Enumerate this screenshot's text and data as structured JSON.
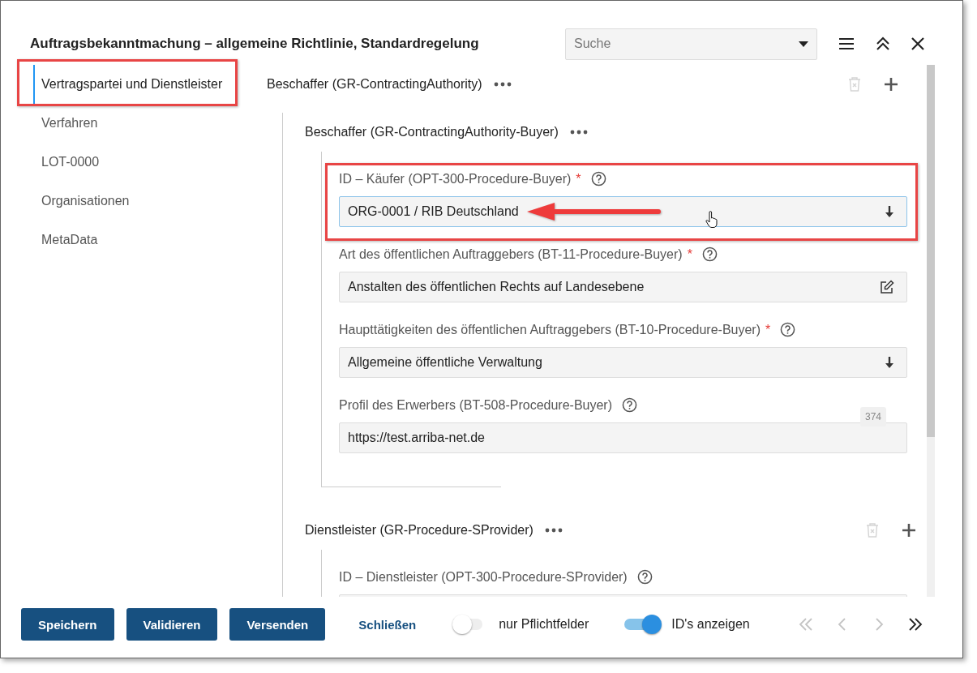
{
  "window": {
    "title": "Auftragsbekanntmachung – allgemeine Richtlinie, Standardregelung"
  },
  "search": {
    "placeholder": "Suche"
  },
  "sidebar": {
    "items": [
      {
        "label": "Vertragspartei und Dienstleister",
        "selected": true,
        "highlighted": true
      },
      {
        "label": "Verfahren",
        "selected": false
      },
      {
        "label": "LOT-0000",
        "selected": false
      },
      {
        "label": "Organisationen",
        "selected": false
      },
      {
        "label": "MetaData",
        "selected": false
      }
    ]
  },
  "group": {
    "title": "Beschaffer (GR-ContractingAuthority)",
    "delete_disabled": true,
    "subgroups": [
      {
        "title": "Beschaffer (GR-ContractingAuthority-Buyer)",
        "fields": [
          {
            "kind": "dropdown",
            "label": "ID – Käufer (OPT-300-Procedure-Buyer)",
            "required_mark": "*",
            "value": "ORG-0001 / RIB Deutschland",
            "focused": true,
            "highlighted": true,
            "pointer_arrow": true,
            "hover_cursor": true
          },
          {
            "kind": "edit",
            "label": "Art des öffentlichen Auftraggebers (BT-11-Procedure-Buyer)",
            "required_mark": "*",
            "value": "Anstalten des öffentlichen Rechts auf Landesebene",
            "focused": false
          },
          {
            "kind": "dropdown",
            "label": "Haupttätigkeiten des öffentlichen Auftraggebers (BT-10-Procedure-Buyer)",
            "required_mark": "*",
            "value": "Allgemeine öffentliche Verwaltung",
            "focused": false
          },
          {
            "kind": "text",
            "label": "Profil des Erwerbers (BT-508-Procedure-Buyer)",
            "value": "https://test.arriba-net.de",
            "counter": "374",
            "focused": false
          }
        ]
      },
      {
        "title": "Dienstleister (GR-Procedure-SProvider)",
        "delete_disabled": true,
        "fields": [
          {
            "kind": "dropdown",
            "label": "ID – Dienstleister (OPT-300-Procedure-SProvider)",
            "focused": false
          }
        ]
      }
    ]
  },
  "footer": {
    "buttons": [
      "Speichern",
      "Validieren",
      "Versenden"
    ],
    "link": "Schließen",
    "toggles": [
      {
        "label": "nur Pflichtfelder",
        "on": false
      },
      {
        "label": "ID's anzeigen",
        "on": true
      }
    ],
    "nav": [
      {
        "kind": "first",
        "disabled": true
      },
      {
        "kind": "prev",
        "disabled": true
      },
      {
        "kind": "next",
        "disabled": true
      },
      {
        "kind": "last",
        "disabled": false
      }
    ]
  }
}
